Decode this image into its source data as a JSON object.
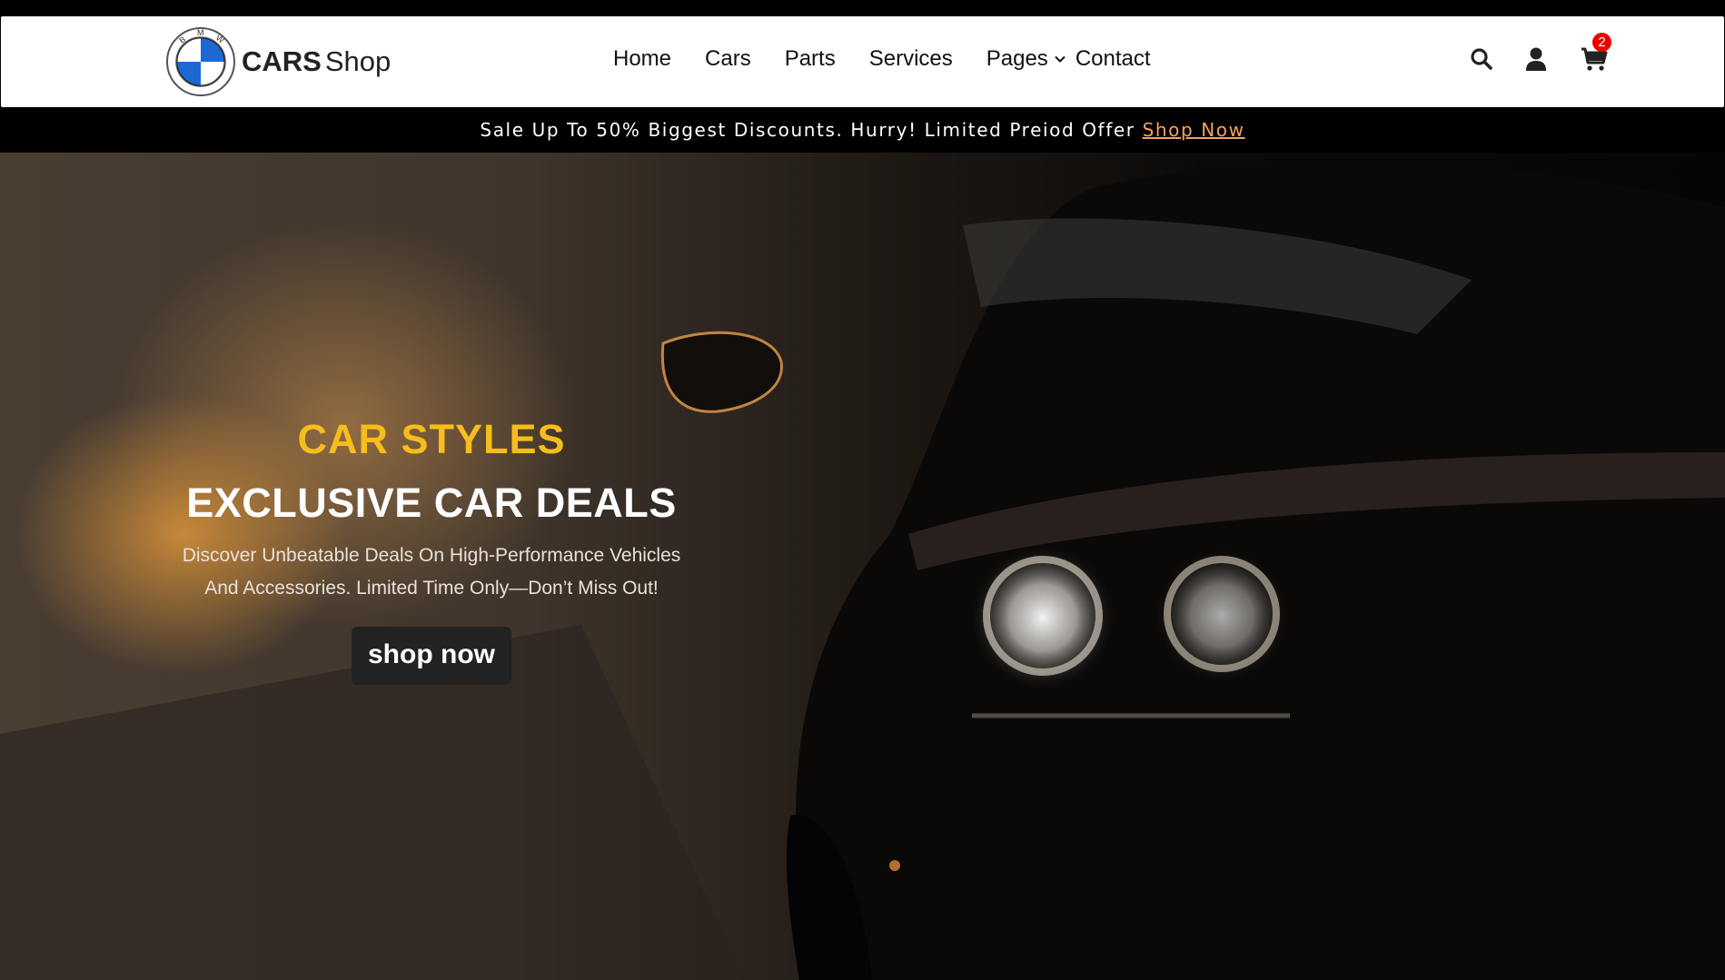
{
  "brand": {
    "badge_letters": [
      "B",
      "M",
      "W"
    ],
    "name_bold": "CARS",
    "name_light": "Shop"
  },
  "nav": {
    "items": [
      {
        "label": "Home"
      },
      {
        "label": "Cars"
      },
      {
        "label": "Parts"
      },
      {
        "label": "Services"
      },
      {
        "label": "Pages",
        "has_dropdown": true
      },
      {
        "label": "Contact"
      }
    ]
  },
  "header_icons": {
    "search": "search-icon",
    "account": "user-icon",
    "cart": "cart-icon",
    "cart_count": "2"
  },
  "promo": {
    "text": "Sale Up To 50% Biggest Discounts. Hurry! Limited Preiod Offer",
    "link": "Shop Now"
  },
  "hero": {
    "kicker": "CAR STYLES",
    "headline": "EXCLUSIVE CAR DEALS",
    "subtitle": "Discover Unbeatable Deals On High-Performance Vehicles And Accessories. Limited Time Only—Don’t Miss Out!",
    "cta": "shop now"
  },
  "colors": {
    "accent": "#f6bd1c",
    "promo_link": "#f4a35a",
    "badge": "#ee0000",
    "logo_blue": "#1c69d4"
  }
}
